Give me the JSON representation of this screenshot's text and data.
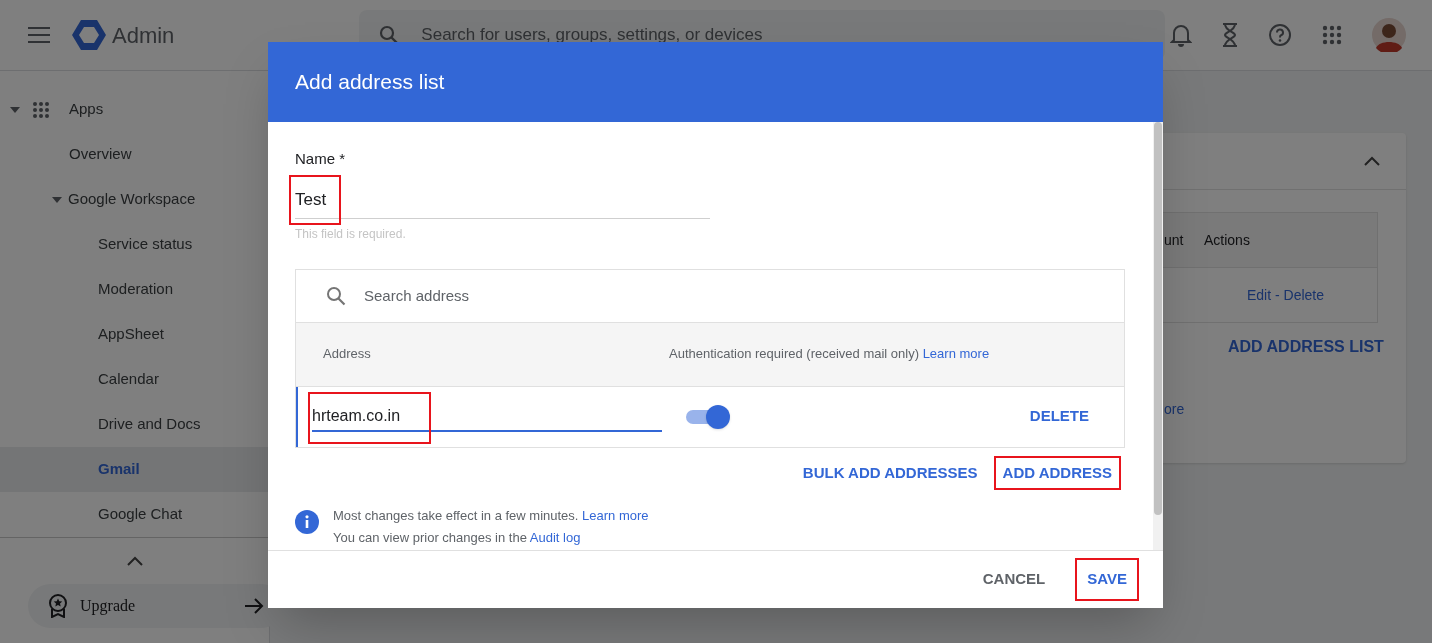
{
  "header": {
    "product": "Admin",
    "search_placeholder": "Search for users, groups, settings, or devices"
  },
  "sidebar": {
    "items": [
      {
        "label": "Apps",
        "expanded": true,
        "selected": false,
        "children": [
          {
            "label": "Overview",
            "selected": false
          },
          {
            "label": "Google Workspace",
            "expanded": true,
            "selected": false,
            "children": [
              {
                "label": "Service status",
                "selected": false
              },
              {
                "label": "Moderation",
                "selected": false
              },
              {
                "label": "AppSheet",
                "selected": false
              },
              {
                "label": "Calendar",
                "selected": false
              },
              {
                "label": "Drive and Docs",
                "selected": false
              },
              {
                "label": "Gmail",
                "selected": true
              },
              {
                "label": "Google Chat",
                "selected": false
              }
            ]
          }
        ]
      }
    ],
    "upgrade": "Upgrade"
  },
  "background_card": {
    "columns": [
      "unt",
      "Actions"
    ],
    "rows": [
      {
        "actions": "Edit - Delete"
      }
    ],
    "add_button": "ADD ADDRESS LIST",
    "link": "ore"
  },
  "dialog": {
    "title": "Add address list",
    "name_label": "Name *",
    "name_value": "Test",
    "name_highlighted": true,
    "hint": "This field is required.",
    "search_placeholder": "Search address",
    "columns": [
      {
        "label": "Address"
      },
      {
        "label": "Authentication required (received mail only)",
        "link": "Learn more"
      }
    ],
    "rows": [
      {
        "address": "hrteam.co.in",
        "highlighted": true,
        "auth_required": true,
        "delete": "DELETE"
      }
    ],
    "actions": [
      {
        "label": "BULK ADD ADDRESSES",
        "highlighted": false
      },
      {
        "label": "ADD ADDRESS",
        "highlighted": true
      }
    ],
    "info": [
      {
        "text": "Most changes take effect in a few minutes.",
        "link": "Learn more"
      },
      {
        "text": "You can view prior changes in the",
        "link": "Audit log"
      }
    ],
    "buttons": [
      {
        "label": "CANCEL",
        "kind": "secondary",
        "highlighted": false
      },
      {
        "label": "SAVE",
        "kind": "primary",
        "highlighted": true
      }
    ]
  }
}
